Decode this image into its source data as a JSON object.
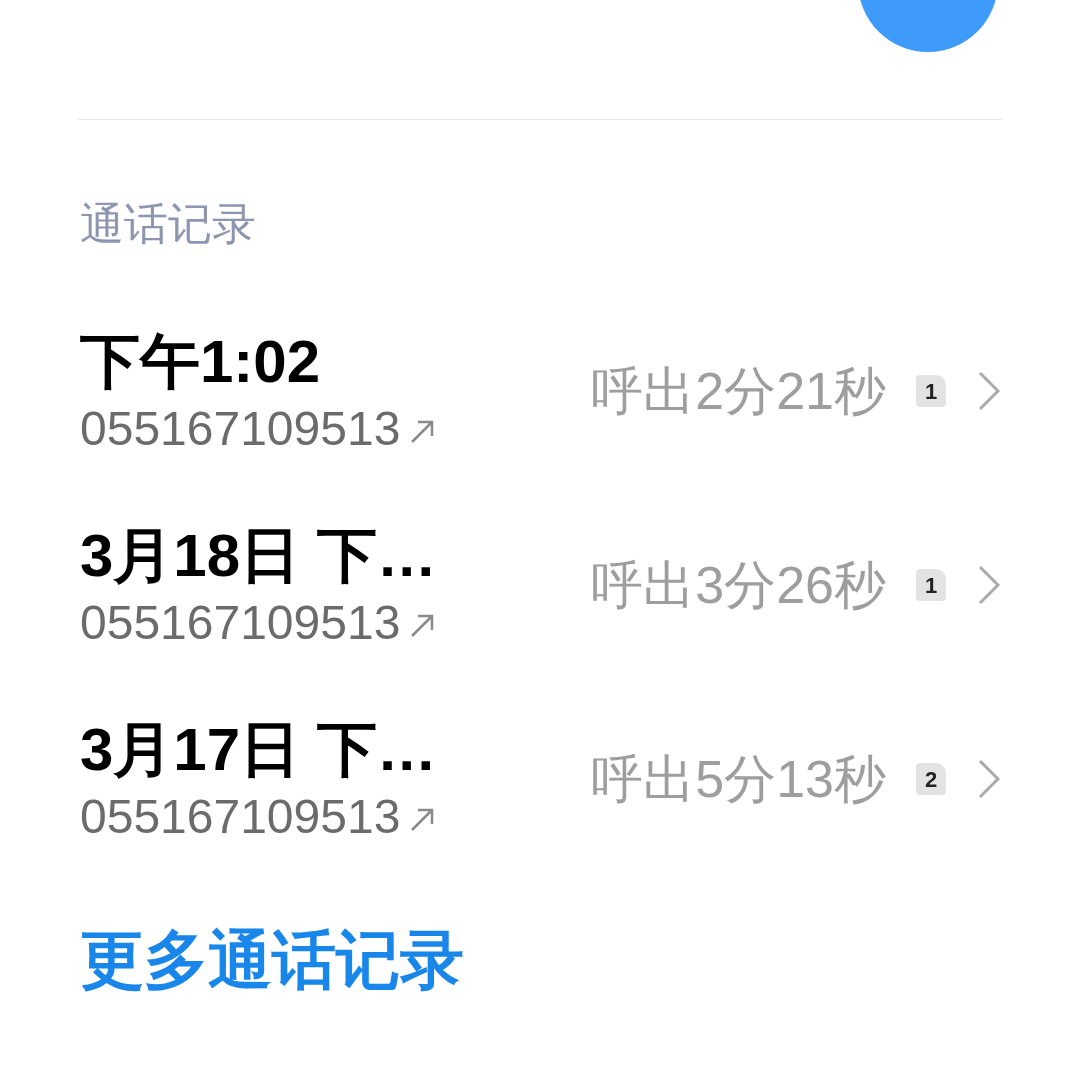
{
  "section": {
    "title": "通话记录"
  },
  "calls": [
    {
      "time": "下午1:02",
      "number": "055167109513",
      "duration": "呼出2分21秒",
      "sim": "1"
    },
    {
      "time": "3月18日 下…",
      "number": "055167109513",
      "duration": "呼出3分26秒",
      "sim": "1"
    },
    {
      "time": "3月17日 下…",
      "number": "055167109513",
      "duration": "呼出5分13秒",
      "sim": "2"
    }
  ],
  "more_link": "更多通话记录"
}
